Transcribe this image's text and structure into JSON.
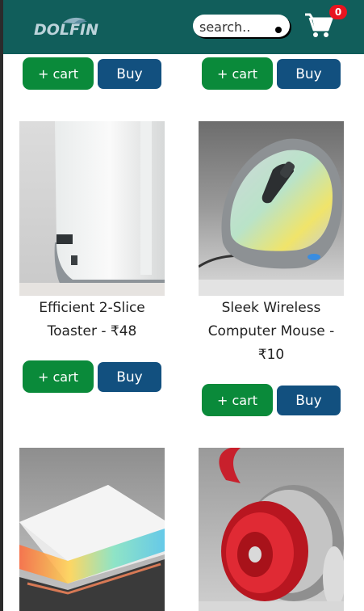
{
  "header": {
    "logo_text": "DOLFIN",
    "search_placeholder": "search..",
    "cart_count": "0"
  },
  "top_row": {
    "left": {
      "cart_label": "+ cart",
      "buy_label": "Buy"
    },
    "right": {
      "cart_label": "+ cart",
      "buy_label": "Buy"
    }
  },
  "products": [
    {
      "image_icon": "toaster-image",
      "title_line1": "Efficient 2-Slice",
      "title_line2": "Toaster - ₹48",
      "cart_label": "+ cart",
      "buy_label": "Buy"
    },
    {
      "image_icon": "computer-mouse-image",
      "title_line1": "Sleek Wireless",
      "title_line2": "Computer Mouse -",
      "title_line3": "₹10",
      "cart_label": "+ cart",
      "buy_label": "Buy"
    },
    {
      "image_icon": "laptop-image"
    },
    {
      "image_icon": "headphones-image"
    }
  ],
  "colors": {
    "header_bg": "#115e5b",
    "cart_button": "#0a8a3a",
    "buy_button": "#12507f",
    "badge": "#e8141f"
  }
}
